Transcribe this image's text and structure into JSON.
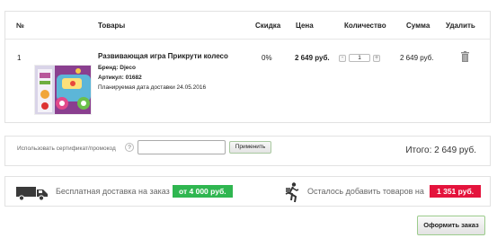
{
  "table": {
    "headers": {
      "num": "№",
      "goods": "Товары",
      "discount": "Скидка",
      "price": "Цена",
      "quantity": "Количество",
      "sum": "Сумма",
      "delete": "Удалить"
    },
    "rows": [
      {
        "num": "1",
        "name": "Развивающая игра Прикрути колесо",
        "brand_label": "Бренд:",
        "brand": "Djeco",
        "article_label": "Артикул:",
        "article": "01682",
        "delivery": "Планируемая дата доставки 24.05.2016",
        "discount": "0%",
        "price": "2 649 руб.",
        "quantity": "1",
        "minus": "-",
        "plus": "+",
        "sum": "2 649 руб."
      }
    ]
  },
  "promo": {
    "label": "Использовать сертификат/промокод",
    "help": "?",
    "input_value": "",
    "apply_label": "Применить",
    "total": "Итого: 2 649 руб."
  },
  "shipping": {
    "free_text": "Бесплатная доставка на заказ",
    "free_threshold": "от 4 000 руб.",
    "remain_text": "Осталось добавить товаров на",
    "remain_amount": "1 351 руб."
  },
  "order_button": "Оформить заказ",
  "colors": {
    "green": "#2fb650",
    "red": "#e4133c"
  }
}
